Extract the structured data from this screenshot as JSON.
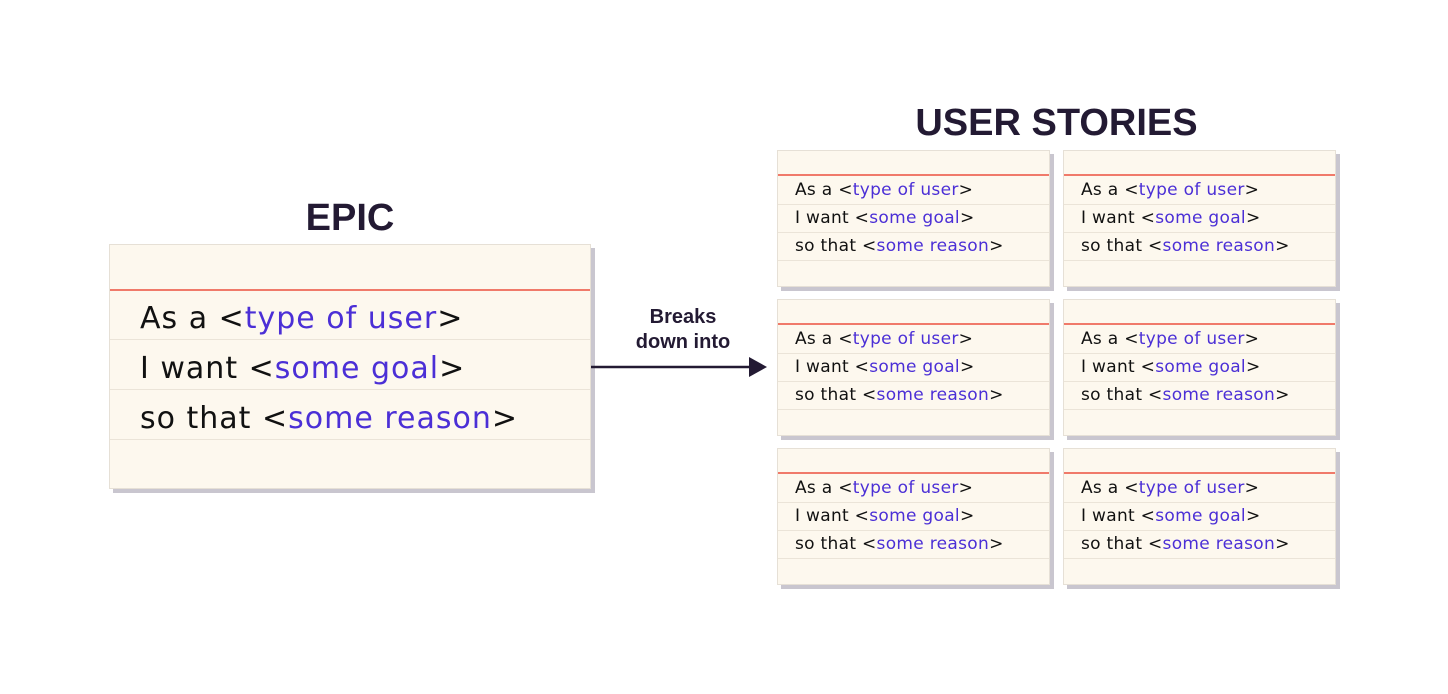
{
  "epic": {
    "title": "EPIC",
    "lines": [
      {
        "prefix": "As a <",
        "highlight": "type of user",
        "suffix": ">"
      },
      {
        "prefix": "I want <",
        "highlight": "some goal",
        "suffix": ">"
      },
      {
        "prefix": "so that <",
        "highlight": "some reason",
        "suffix": ">"
      }
    ]
  },
  "connector": {
    "label_line1": "Breaks",
    "label_line2": "down into"
  },
  "user_stories": {
    "title": "USER STORIES",
    "cards": [
      {
        "lines": [
          {
            "prefix": "As a <",
            "highlight": "type of user",
            "suffix": ">"
          },
          {
            "prefix": "I want <",
            "highlight": "some goal",
            "suffix": ">"
          },
          {
            "prefix": "so that <",
            "highlight": "some reason",
            "suffix": ">"
          }
        ]
      },
      {
        "lines": [
          {
            "prefix": "As a <",
            "highlight": "type of user",
            "suffix": ">"
          },
          {
            "prefix": "I want <",
            "highlight": "some goal",
            "suffix": ">"
          },
          {
            "prefix": "so that <",
            "highlight": "some reason",
            "suffix": ">"
          }
        ]
      },
      {
        "lines": [
          {
            "prefix": "As a <",
            "highlight": "type of user",
            "suffix": ">"
          },
          {
            "prefix": "I want <",
            "highlight": "some goal",
            "suffix": ">"
          },
          {
            "prefix": "so that <",
            "highlight": "some reason",
            "suffix": ">"
          }
        ]
      },
      {
        "lines": [
          {
            "prefix": "As a <",
            "highlight": "type of user",
            "suffix": ">"
          },
          {
            "prefix": "I want <",
            "highlight": "some goal",
            "suffix": ">"
          },
          {
            "prefix": "so that <",
            "highlight": "some reason",
            "suffix": ">"
          }
        ]
      },
      {
        "lines": [
          {
            "prefix": "As a <",
            "highlight": "type of user",
            "suffix": ">"
          },
          {
            "prefix": "I want <",
            "highlight": "some goal",
            "suffix": ">"
          },
          {
            "prefix": "so that <",
            "highlight": "some reason",
            "suffix": ">"
          }
        ]
      },
      {
        "lines": [
          {
            "prefix": "As a <",
            "highlight": "type of user",
            "suffix": ">"
          },
          {
            "prefix": "I want <",
            "highlight": "some goal",
            "suffix": ">"
          },
          {
            "prefix": "so that <",
            "highlight": "some reason",
            "suffix": ">"
          }
        ]
      }
    ]
  },
  "colors": {
    "highlight": "#4b2fd6",
    "margin_line": "#f07a6a",
    "card_bg": "#fdf8ee",
    "heading": "#231a33"
  }
}
